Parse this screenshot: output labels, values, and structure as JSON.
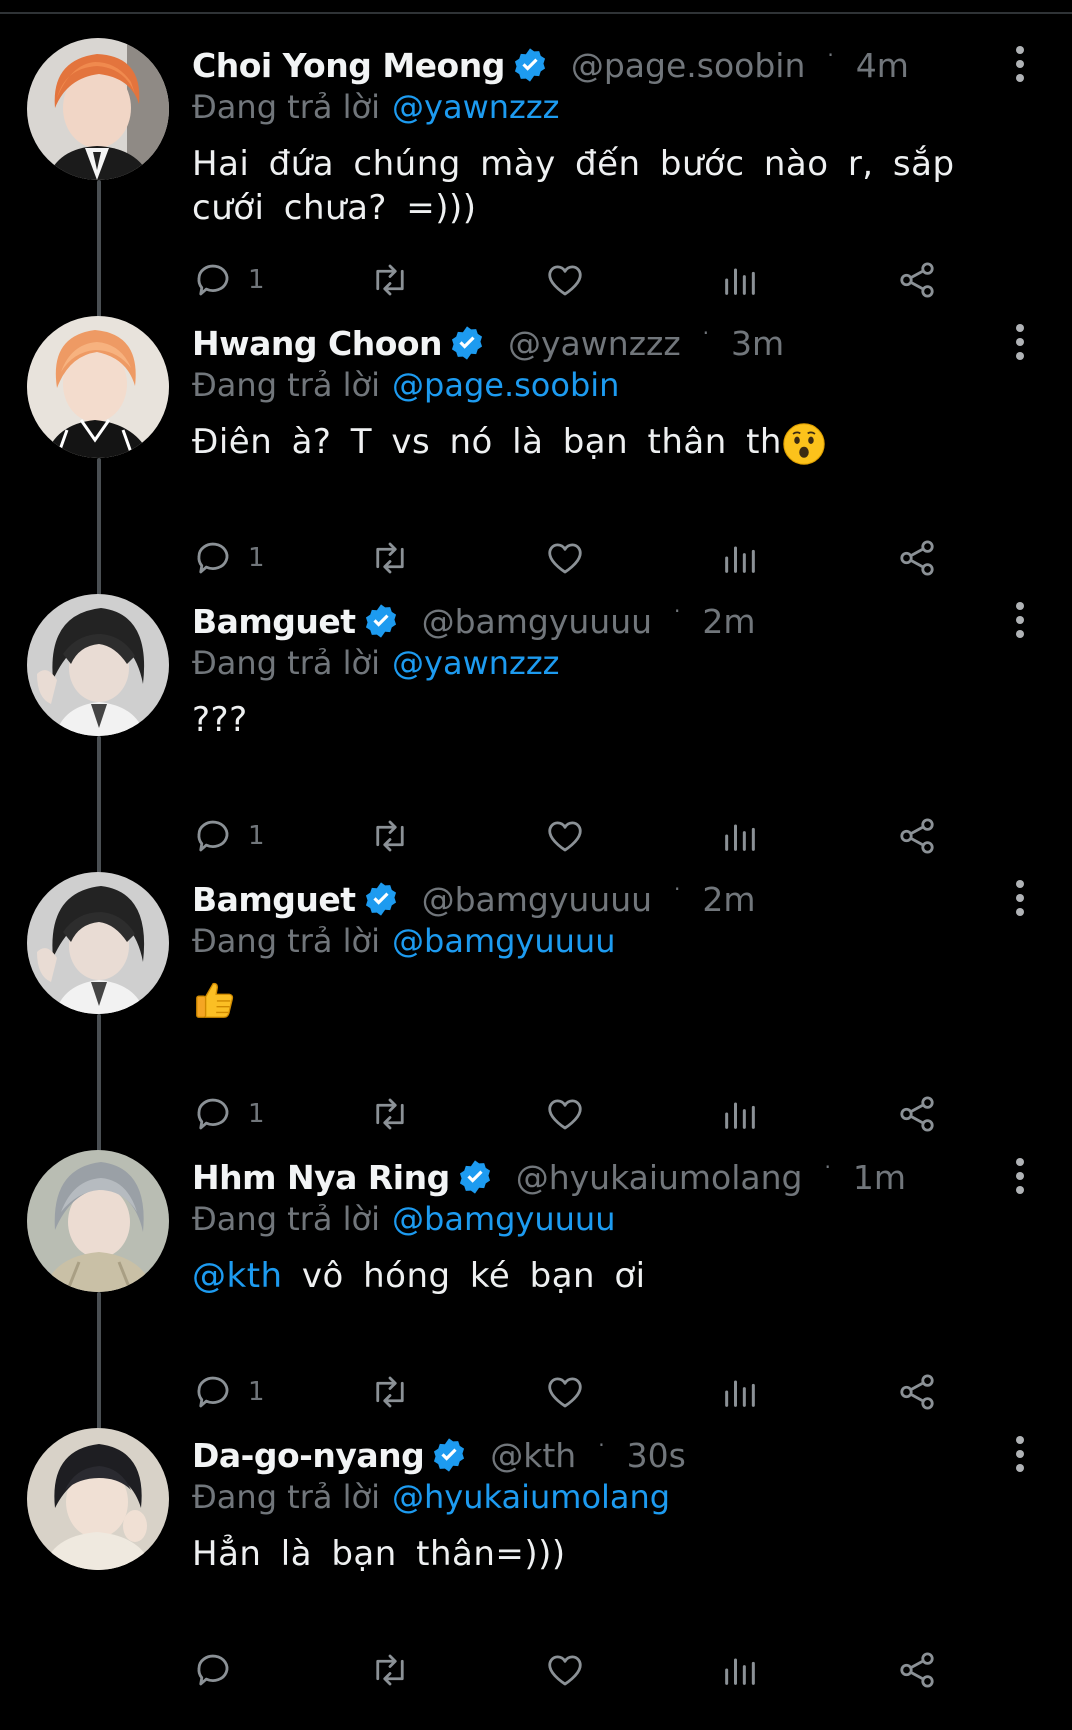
{
  "colors": {
    "background": "#000000",
    "link": "#1d9bf0",
    "muted": "#71767b",
    "verified": "#1d9bf0"
  },
  "replying_label": "Đang trả lời",
  "tweets": [
    {
      "name": "Choi Yong Meong",
      "handle": "@page.soobin",
      "time": "4m",
      "reply_to": "@yawnzzz",
      "text": "Hai đứa chúng mày đến bước nào r, sắp cưới chưa? =)))",
      "reply_count": "1",
      "avatar": "orange-hair-boy-suit-avatar"
    },
    {
      "name": "Hwang Choon",
      "handle": "@yawnzzz",
      "time": "3m",
      "reply_to": "@page.soobin",
      "text": "Điên à? T vs nó là bạn thân th",
      "emoji": "surprised-face-emoji",
      "reply_count": "1",
      "avatar": "orange-hair-boy-jacket-avatar"
    },
    {
      "name": "Bamguet",
      "handle": "@bamgyuuuu",
      "time": "2m",
      "reply_to": "@yawnzzz",
      "text": "???",
      "reply_count": "1",
      "avatar": "black-hair-boy-avatar"
    },
    {
      "name": "Bamguet",
      "handle": "@bamgyuuuu",
      "time": "2m",
      "reply_to": "@bamgyuuuu",
      "text": "",
      "emoji": "thumbs-up-emoji",
      "reply_count": "1",
      "avatar": "black-hair-boy-avatar"
    },
    {
      "name": "Hhm Nya Ring",
      "handle": "@hyukaiumolang",
      "time": "1m",
      "reply_to": "@bamgyuuuu",
      "text_mention": "@kth",
      "text": " vô hóng ké bạn ơi",
      "reply_count": "1",
      "avatar": "grey-hair-boy-avatar"
    },
    {
      "name": "Da-go-nyang",
      "handle": "@kth",
      "time": "30s",
      "reply_to": "@hyukaiumolang",
      "text": "Hẳn là bạn thân=)))",
      "reply_count": "",
      "avatar": "dark-hair-boy-avatar"
    }
  ]
}
